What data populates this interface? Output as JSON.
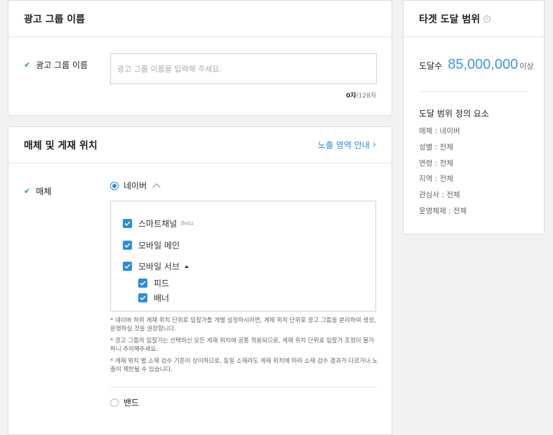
{
  "ad_group": {
    "header_title": "광고 그룹 이름",
    "field_label": "광고 그룹 이름",
    "input_value": "",
    "input_placeholder": "광고 그룹 이름을 입력해 주세요.",
    "char_count": "0자",
    "char_limit": "/128자"
  },
  "media": {
    "header_title": "매체 및 게재 위치",
    "guide_link": "노출 영역 안내",
    "field_label": "매체",
    "options": [
      {
        "label": "네이버",
        "selected": true,
        "expanded": true
      },
      {
        "label": "밴드",
        "selected": false
      }
    ],
    "placements": {
      "smart_channel": {
        "label": "스마트채널",
        "badge": "Beta",
        "checked": true
      },
      "mobile_main": {
        "label": "모바일 메인",
        "checked": true
      },
      "mobile_sub": {
        "label": "모바일 서브",
        "checked": true,
        "expanded": true
      },
      "feed": {
        "label": "피드",
        "checked": true
      },
      "banner": {
        "label": "배너",
        "checked": true
      }
    },
    "notes": [
      "* 네이버 하위 게재 위치 단위로 입찰가를 개별 설정하시려면, 게재 위치 단위로 광고 그룹을 분리하여 생성, 운영하실 것을 권장합니다.",
      "* 광고 그룹의 입찰가는 선택하신 모든 게재 위치에 공통 적용되므로, 게재 위치 단위로 입찰가 조정이 불가하니 주의해주세요.",
      "* 게재 위치 별 소재 검수 기준이 상이하므로, 동일 소재라도 게재 위치에 따라 소재 검수 결과가 다르거나 노출이 제한될 수 있습니다."
    ]
  },
  "target": {
    "header_title": "타겟 도달 범위",
    "reach_label": "도달수",
    "reach_value": "85,000,000",
    "reach_suffix": "이상",
    "definition_title": "도달 범위 정의 요소",
    "definitions": [
      "매체 : 네이버",
      "성별 : 전체",
      "연령 : 전체",
      "지역 : 전체",
      "관심사 : 전체",
      "운영체제 : 전체"
    ]
  },
  "colors": {
    "accent": "#2b8ae6",
    "reach_number": "#3f95e3",
    "valid_check": "#1faa44"
  }
}
